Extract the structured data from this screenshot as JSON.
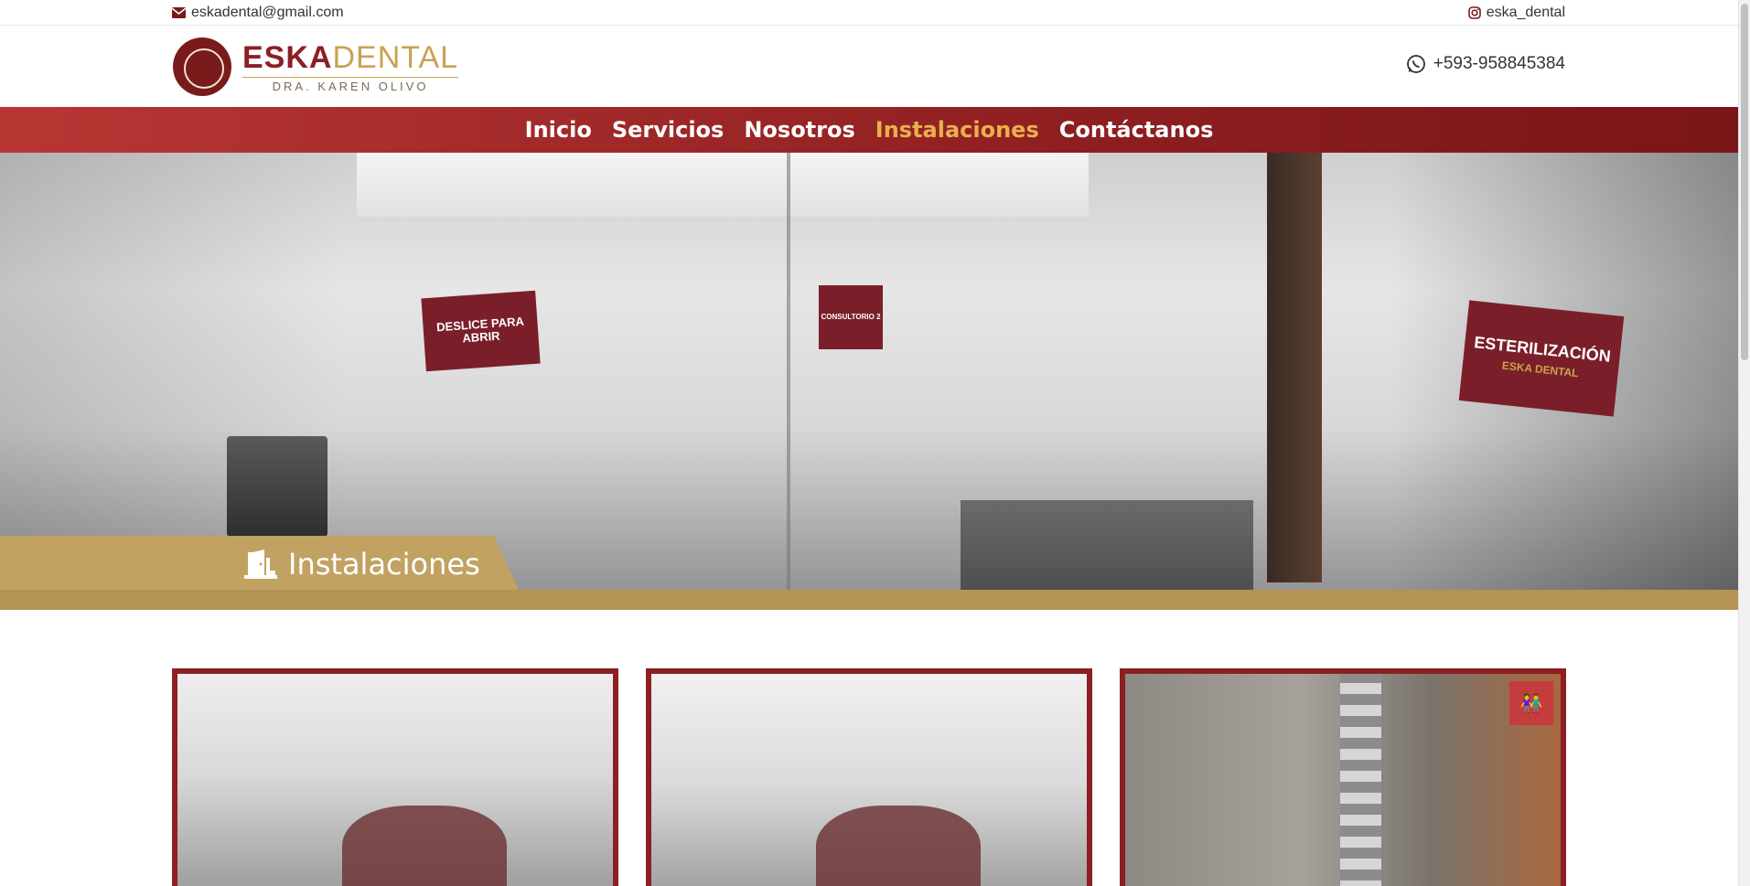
{
  "topbar": {
    "email": "eskadental@gmail.com",
    "email_icon": "envelope-icon",
    "instagram": "eska_dental",
    "instagram_icon": "instagram-icon"
  },
  "header": {
    "logo_title_part1": "ESKA",
    "logo_title_part2": "DENTAL",
    "logo_subtitle": "DRA. KAREN OLIVO",
    "phone": "+593-958845384",
    "phone_icon": "whatsapp-icon"
  },
  "nav": {
    "items": [
      {
        "label": "Inicio",
        "active": false
      },
      {
        "label": "Servicios",
        "active": false
      },
      {
        "label": "Nosotros",
        "active": false
      },
      {
        "label": "Instalaciones",
        "active": true
      },
      {
        "label": "Contáctanos",
        "active": false
      }
    ]
  },
  "hero": {
    "title": "Instalaciones",
    "title_icon": "door-open-icon",
    "sign_1": "DESLICE PARA ABRIR",
    "sign_2": "CONSULTORIO 2",
    "sign_3_main": "ESTERILIZACIÓN",
    "sign_3_sub": "ESKA DENTAL"
  },
  "colors": {
    "brand_red": "#8b1f24",
    "brand_gold": "#c1a262",
    "nav_active": "#e8b04e"
  }
}
